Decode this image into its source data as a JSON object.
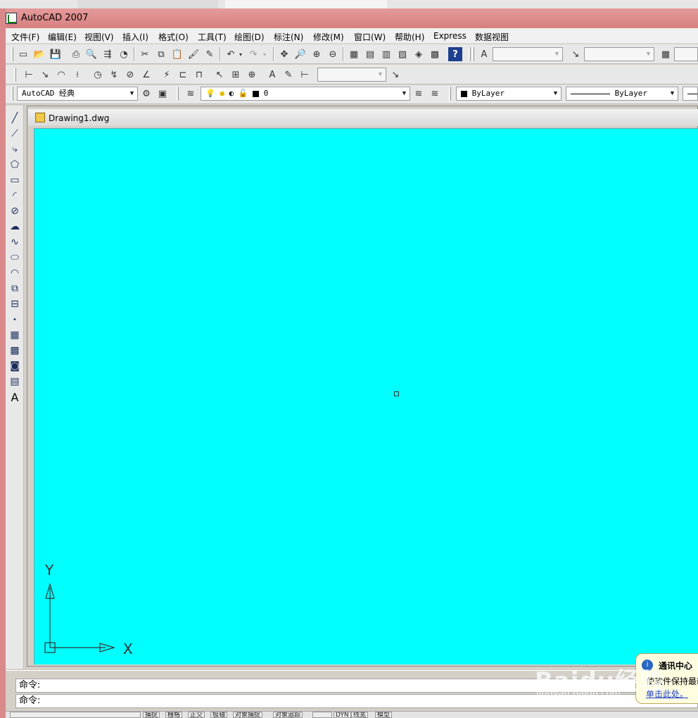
{
  "window": {
    "title": "AutoCAD 2007"
  },
  "menubar": {
    "items": [
      "文件(F)",
      "编辑(E)",
      "视图(V)",
      "插入(I)",
      "格式(O)",
      "工具(T)",
      "绘图(D)",
      "标注(N)",
      "修改(M)",
      "窗口(W)",
      "帮助(H)",
      "Express",
      "数据视图"
    ]
  },
  "toolbar_row3": {
    "workspace": "AutoCAD 经典",
    "layer": "0",
    "color": "ByLayer",
    "linetype": "ByLayer"
  },
  "document": {
    "title": "Drawing1.dwg"
  },
  "canvas": {
    "background": "#00ffff"
  },
  "ucs": {
    "x_label": "X",
    "y_label": "Y"
  },
  "command": {
    "line1": "命令:",
    "line2": "命令:"
  },
  "statusbar": {
    "items": [
      "捕捉",
      "栅格",
      "正交",
      "极轴",
      "对象捕捉",
      "对象追踪",
      "DYN",
      "线宽",
      "模型"
    ]
  },
  "comm_center": {
    "title": "通讯中心",
    "text": "使软件保持最新",
    "link": "单击此处。"
  },
  "watermark": {
    "text": "Baidu经验",
    "sub": "jingyan.baidu.com"
  },
  "icons": {
    "standard": [
      "new-icon",
      "open-icon",
      "save-icon",
      "print-icon",
      "print-preview-icon",
      "publish-icon",
      "3d-dwf-icon",
      "cut-icon",
      "copy-icon",
      "paste-icon",
      "match-properties-icon",
      "block-editor-icon",
      "undo-icon",
      "redo-icon",
      "pan-icon",
      "zoom-realtime-icon",
      "zoom-window-icon",
      "zoom-previous-icon",
      "properties-icon",
      "design-center-icon",
      "tool-palettes-icon",
      "sheet-set-icon",
      "markup-icon",
      "calculator-icon",
      "help-icon"
    ],
    "draw": [
      "line-icon",
      "construction-line-icon",
      "polyline-icon",
      "polygon-icon",
      "rectangle-icon",
      "arc-icon",
      "circle-icon",
      "revision-cloud-icon",
      "spline-icon",
      "ellipse-icon",
      "ellipse-arc-icon",
      "insert-block-icon",
      "make-block-icon",
      "point-icon",
      "hatch-icon",
      "gradient-icon",
      "region-icon",
      "table-icon",
      "multiline-text-icon"
    ]
  }
}
